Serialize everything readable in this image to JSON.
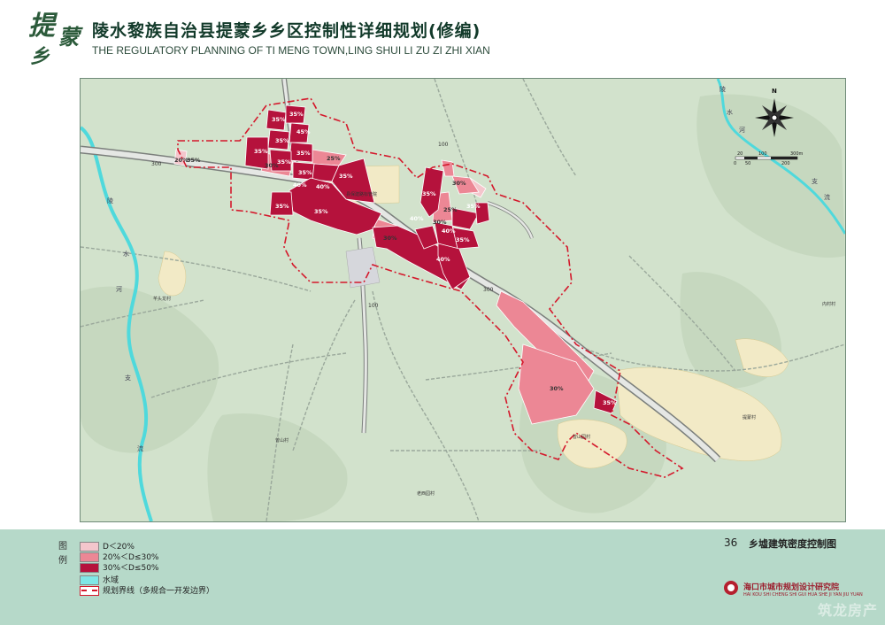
{
  "header": {
    "logo_chars": [
      "提",
      "蒙",
      "乡"
    ],
    "title_cn": "陵水黎族自治县提蒙乡乡区控制性详细规划(修编)",
    "title_en": "THE  REGULATORY PLANNING OF TI MENG TOWN,LING SHUI LI ZU ZI ZHI XIAN"
  },
  "map": {
    "density_labels": [
      "35%",
      "35%",
      "35%",
      "45%",
      "35%",
      "35%",
      "20%",
      "35%",
      "30%",
      "25%",
      "35%",
      "35%",
      "35%",
      "40%",
      "40%",
      "35%",
      "35%",
      "35%",
      "30%",
      "40%",
      "30%",
      "25%",
      "35%",
      "40%",
      "35%",
      "40%",
      "30%",
      "30%",
      "35%"
    ],
    "place_labels": [
      "县保建路标管院",
      "芊头龙村",
      "曾山村",
      "曾山园村",
      "老西园村",
      "内村村",
      "提蒙村"
    ],
    "road_labels": [
      "300",
      "300",
      "100",
      "100"
    ],
    "river_labels": [
      "陵",
      "水",
      "河",
      "支",
      "流",
      "陵",
      "水",
      "河",
      "支",
      "流"
    ],
    "scale_bar": {
      "ticks_top": [
        "20",
        "100",
        "300m"
      ],
      "ticks_bottom": [
        "0",
        "50",
        "200"
      ]
    },
    "north_label": "N"
  },
  "legend": {
    "title_chars": [
      "图",
      "例"
    ],
    "items": [
      {
        "label": "D＜20%",
        "color": "#f4c6cc"
      },
      {
        "label": "20%＜D≤30%",
        "color": "#ec8795"
      },
      {
        "label": "30%＜D≤50%",
        "color": "#b5123c"
      },
      {
        "label": "水域",
        "color": "#7fe7e6"
      },
      {
        "label": "规划界线（多规合一开发边界）",
        "color": "#ffffff"
      }
    ]
  },
  "sheet": {
    "number": "36",
    "title": "乡墟建筑密度控制图"
  },
  "institute": {
    "name": "海口市城市规划设计研究院",
    "subtitle": "HAI KOU SHI CHENG SHI GUI HUA SHE JI YAN JIU YUAN"
  },
  "watermark": "筑龙房产"
}
